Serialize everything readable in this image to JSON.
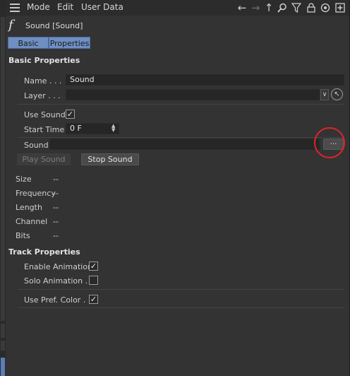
{
  "menubar": {
    "items": [
      "Mode",
      "Edit",
      "User Data"
    ]
  },
  "toolbar_icons": [
    "arrow-left-icon",
    "arrow-right-icon",
    "arrow-up-icon",
    "search-icon",
    "filter-icon",
    "lock-icon",
    "target-icon",
    "add-icon"
  ],
  "object": {
    "icon": "f",
    "title": "Sound [Sound]"
  },
  "tabs": [
    "Basic",
    "Properties"
  ],
  "basic": {
    "heading": "Basic Properties",
    "name_label": "Name . . .",
    "name_value": "Sound",
    "layer_label": "Layer . . .",
    "layer_value": ""
  },
  "props": {
    "use_sound_label": "Use Sound",
    "use_sound_checked": true,
    "start_time_label": "Start Time",
    "start_time_value": "0 F",
    "sound_label": "Sound",
    "sound_value": "",
    "browse_label": "...",
    "play_label": "Play Sound",
    "stop_label": "Stop Sound",
    "info": [
      {
        "label": "Size",
        "value": "--"
      },
      {
        "label": "Frequency",
        "value": "--"
      },
      {
        "label": "Length",
        "value": "--"
      },
      {
        "label": "Channel",
        "value": "--"
      },
      {
        "label": "Bits",
        "value": "--"
      }
    ]
  },
  "track": {
    "heading": "Track Properties",
    "enable_label": "Enable Animation",
    "enable_checked": true,
    "solo_label": "Solo Animation .",
    "solo_checked": false,
    "pref_color_label": "Use Pref. Color .",
    "pref_color_checked": true
  },
  "colors": {
    "tab_active": "#6f8fc2",
    "highlight_circle": "#e0242a",
    "panel_bg": "#333333"
  }
}
